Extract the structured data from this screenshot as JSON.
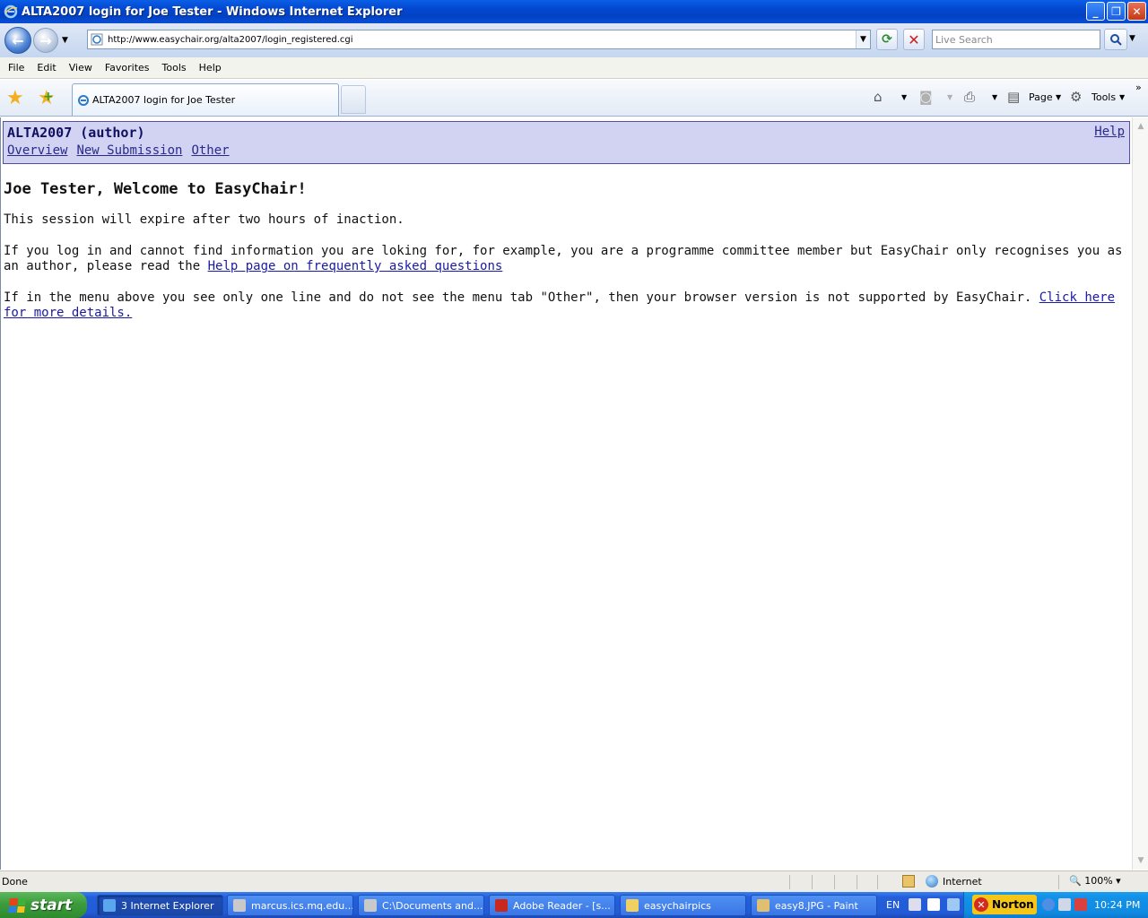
{
  "window": {
    "title": "ALTA2007 login for Joe Tester - Windows Internet Explorer"
  },
  "addressbar": {
    "url": "http://www.easychair.org/alta2007/login_registered.cgi",
    "search_placeholder": "Live Search"
  },
  "menubar": {
    "items": [
      "File",
      "Edit",
      "View",
      "Favorites",
      "Tools",
      "Help"
    ]
  },
  "tabs": {
    "active_label": "ALTA2007 login for Joe Tester"
  },
  "toolbar": {
    "page_label": "Page",
    "tools_label": "Tools"
  },
  "page": {
    "conference_title": "ALTA2007 (author)",
    "help_link": "Help",
    "menu": [
      "Overview",
      "New Submission",
      "Other"
    ],
    "heading": "Joe Tester, Welcome to EasyChair!",
    "session_note": "This session will expire after two hours of inaction.",
    "faq_text": "If you log in and cannot find information you are loking for, for example, you are a programme committee member but EasyChair only recognises you as an author, please read the",
    "faq_link": "Help page on frequently asked questions",
    "browser_text": "If in the menu above you see only one line and do not see the menu tab \"Other\", then your browser version is not supported by EasyChair.",
    "browser_link": "Click here for more details."
  },
  "statusbar": {
    "status": "Done",
    "zone": "Internet",
    "zoom": "100%"
  },
  "taskbar": {
    "start_label": "start",
    "items": [
      {
        "label": "3 Internet Explorer",
        "icon": "ie-icon"
      },
      {
        "label": "marcus.ics.mq.edu...",
        "icon": "putty-icon"
      },
      {
        "label": "C:\\Documents and...",
        "icon": "putty-icon"
      },
      {
        "label": "Adobe Reader - [s...",
        "icon": "adobe-icon"
      },
      {
        "label": "easychairpics",
        "icon": "folder-icon"
      },
      {
        "label": "easy8.JPG - Paint",
        "icon": "paint-icon"
      }
    ],
    "language": "EN",
    "antivirus": "Norton",
    "clock": "10:24 PM"
  },
  "colors": {
    "titlebar": "#0346d0",
    "ec_header_bg": "#d2d2f2",
    "ec_header_border": "#5050a8",
    "link": "#1a1aa6",
    "taskbar": "#245edb",
    "start": "#3c9c3c"
  }
}
